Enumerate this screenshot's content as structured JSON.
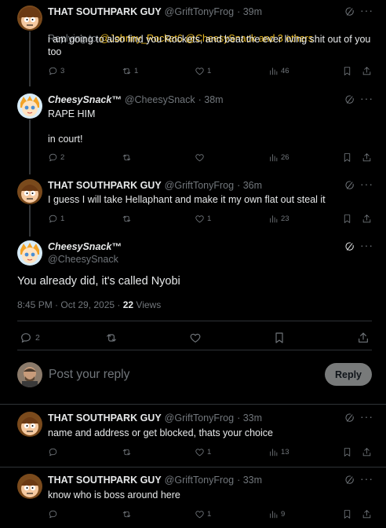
{
  "posts": [
    {
      "name": "THAT SOUTHPARK GUY",
      "handle": "@GriftTonyFrog",
      "time": "· 39m",
      "replying_prefix": "Replying to ",
      "replying_targets": "@Johnny_Rocket6 @CheesySnack and 3 others",
      "text": "i am going to also find you Rockets, and beat the ever living shit out of you too",
      "replies": "3",
      "reposts": "1",
      "likes": "1",
      "views": "46"
    },
    {
      "name": "CheesySnack™",
      "handle": "@CheesySnack",
      "time": "· 38m",
      "text": "RAPE HIM\n\nin court!",
      "replies": "2",
      "reposts": "",
      "likes": "",
      "views": "26"
    },
    {
      "name": "THAT SOUTHPARK GUY",
      "handle": "@GriftTonyFrog",
      "time": "· 36m",
      "text": "I guess I will take Hellaphant and make it my own flat out steal it",
      "replies": "1",
      "reposts": "",
      "likes": "1",
      "views": "23"
    }
  ],
  "focused": {
    "name": "CheesySnack™",
    "handle": "@CheesySnack",
    "text": "You already did, it's called Nyobi",
    "timestamp": "8:45 PM · Oct 29, 2025 · ",
    "views_count": "22",
    "views_label": " Views",
    "replies": "2"
  },
  "composer": {
    "placeholder": "Post your reply",
    "button": "Reply"
  },
  "replies_below": [
    {
      "name": "THAT SOUTHPARK GUY",
      "handle": "@GriftTonyFrog",
      "time": "· 33m",
      "text": "name and address or get blocked, thats your choice",
      "likes": "1",
      "views": "13"
    },
    {
      "name": "THAT SOUTHPARK GUY",
      "handle": "@GriftTonyFrog",
      "time": "· 33m",
      "text": "know who is boss around here",
      "likes": "1",
      "views": "9"
    }
  ],
  "colors": {
    "background": "#000000",
    "text": "#e7e9ea",
    "secondary": "#71767b",
    "mention": "#e8b923",
    "divider": "#2f3336",
    "reply_button": "#787a7a"
  }
}
